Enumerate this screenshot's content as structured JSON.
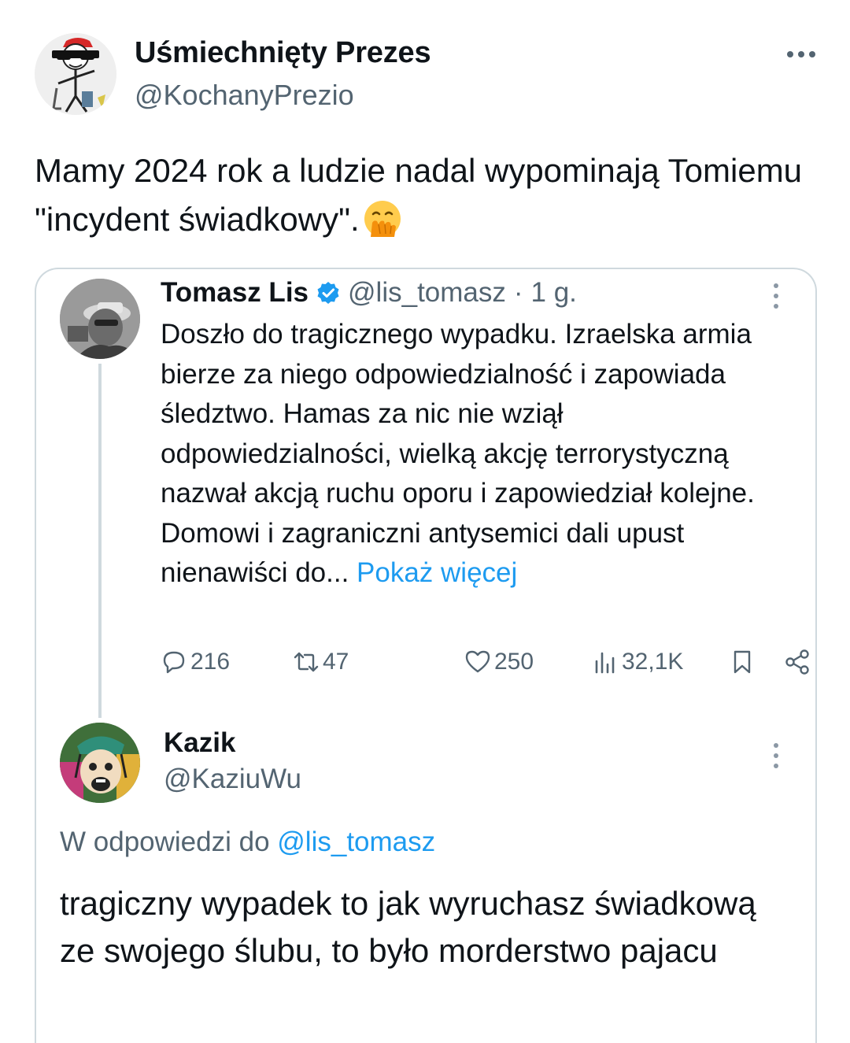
{
  "tweet": {
    "author": {
      "name": "Uśmiechnięty Prezes",
      "handle": "@KochanyPrezio"
    },
    "text": "Mamy 2024 rok a ludzie nadal wypominają Tomiemu \"incydent świadkowy\".",
    "emoji": "face-with-hand-over-mouth"
  },
  "quoted": {
    "name": "Tomasz Lis",
    "handle": "@lis_tomasz",
    "separator": "·",
    "time": "1 g.",
    "text": "Doszło do tragicznego wypadku. Izraelska armia bierze za niego odpowiedzialność i zapowiada śledztwo. Hamas za nic nie wziął odpowiedzialności, wielką akcję terrorystyczną nazwał akcją ruchu oporu i zapowiedział kolejne. Domowi i zagraniczni antysemici dali upust nienawiści do...",
    "show_more": "Pokaż więcej",
    "stats": {
      "replies": "216",
      "retweets": "47",
      "likes": "250",
      "views": "32,1K"
    }
  },
  "reply": {
    "name": "Kazik",
    "handle": "@KaziuWu",
    "reply_prefix": "W odpowiedzi do",
    "reply_to": "@lis_tomasz",
    "text": "tragiczny wypadek to jak wyruchasz świadkową ze swojego ślubu, to było morderstwo pajacu"
  },
  "colors": {
    "link": "#1d9bf0",
    "secondary_text": "#536471",
    "border": "#cfd9de"
  }
}
